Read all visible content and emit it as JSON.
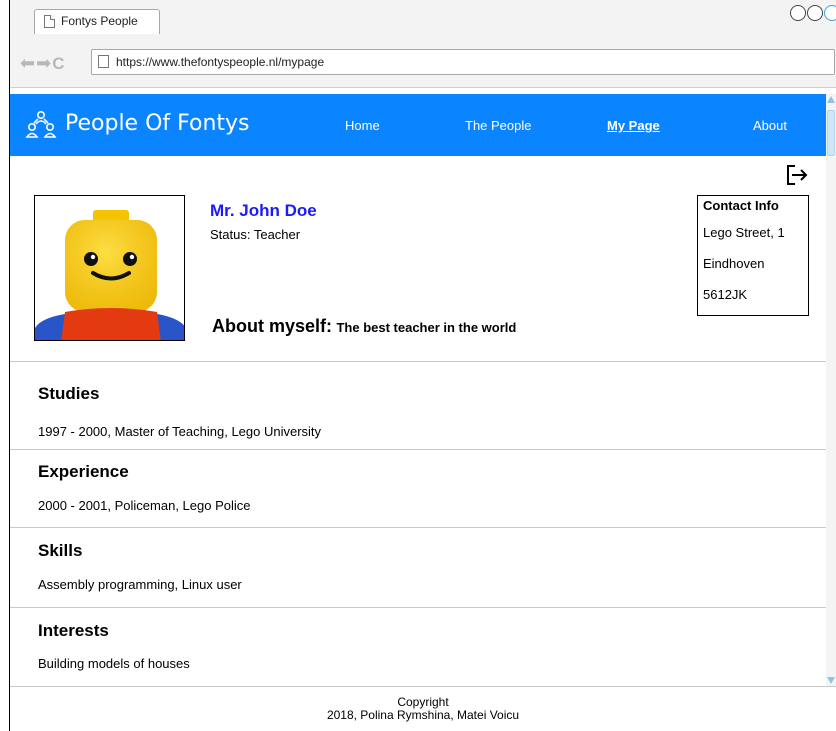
{
  "browser": {
    "tab_title": "Fontys People",
    "url": "https://www.thefontyspeople.nl/mypage"
  },
  "header": {
    "site_title": "People Of Fontys",
    "nav": [
      {
        "label": "Home",
        "active": false
      },
      {
        "label": "The People",
        "active": false
      },
      {
        "label": "My Page",
        "active": true
      },
      {
        "label": "About",
        "active": false
      }
    ],
    "accent_color": "#0a84ff"
  },
  "profile": {
    "name": "Mr. John Doe",
    "status": "Status: Teacher",
    "about_heading": "About myself:",
    "about_text": "The best teacher in the world",
    "avatar_icon": "lego-figure-avatar"
  },
  "contact": {
    "title": "Contact Info",
    "lines": [
      "Lego Street, 1",
      "Eindhoven",
      "5612JK"
    ]
  },
  "sections": [
    {
      "heading": "Studies",
      "body": "1997 - 2000, Master of Teaching, Lego University"
    },
    {
      "heading": "Experience",
      "body": "2000 - 2001, Policeman, Lego Police"
    },
    {
      "heading": "Skills",
      "body": "Assembly programming, Linux user"
    },
    {
      "heading": "Interests",
      "body": "Building models of houses"
    }
  ],
  "footer": {
    "line1": "Copyright",
    "line2": "2018, Polina Rymshina, Matei Voicu"
  }
}
